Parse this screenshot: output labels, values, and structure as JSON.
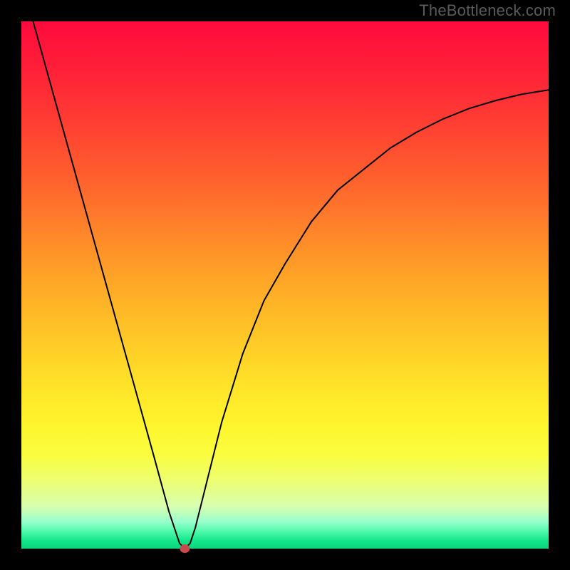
{
  "watermark": "TheBottleneck.com",
  "chart_data": {
    "type": "line",
    "title": "",
    "xlabel": "",
    "ylabel": "",
    "xlim": [
      0,
      100
    ],
    "ylim": [
      0,
      100
    ],
    "series": [
      {
        "name": "bottleneck-curve",
        "x": [
          0,
          5,
          10,
          15,
          20,
          25,
          28,
          30,
          31,
          32,
          33,
          35,
          38,
          42,
          46,
          50,
          55,
          60,
          65,
          70,
          75,
          80,
          85,
          90,
          95,
          100
        ],
        "y": [
          108,
          90,
          72,
          54,
          36,
          18,
          7,
          1,
          0,
          1,
          4,
          12,
          24,
          37,
          47,
          54,
          62,
          68,
          72,
          76,
          79,
          81.5,
          83.5,
          85,
          86.2,
          87
        ]
      }
    ],
    "min_point": {
      "x": 31,
      "y": 0
    },
    "gradient_stops": [
      {
        "pos": 0.0,
        "color": "#ff0a3c"
      },
      {
        "pos": 0.5,
        "color": "#ffc226"
      },
      {
        "pos": 0.8,
        "color": "#fff42c"
      },
      {
        "pos": 1.0,
        "color": "#0ad67a"
      }
    ]
  }
}
